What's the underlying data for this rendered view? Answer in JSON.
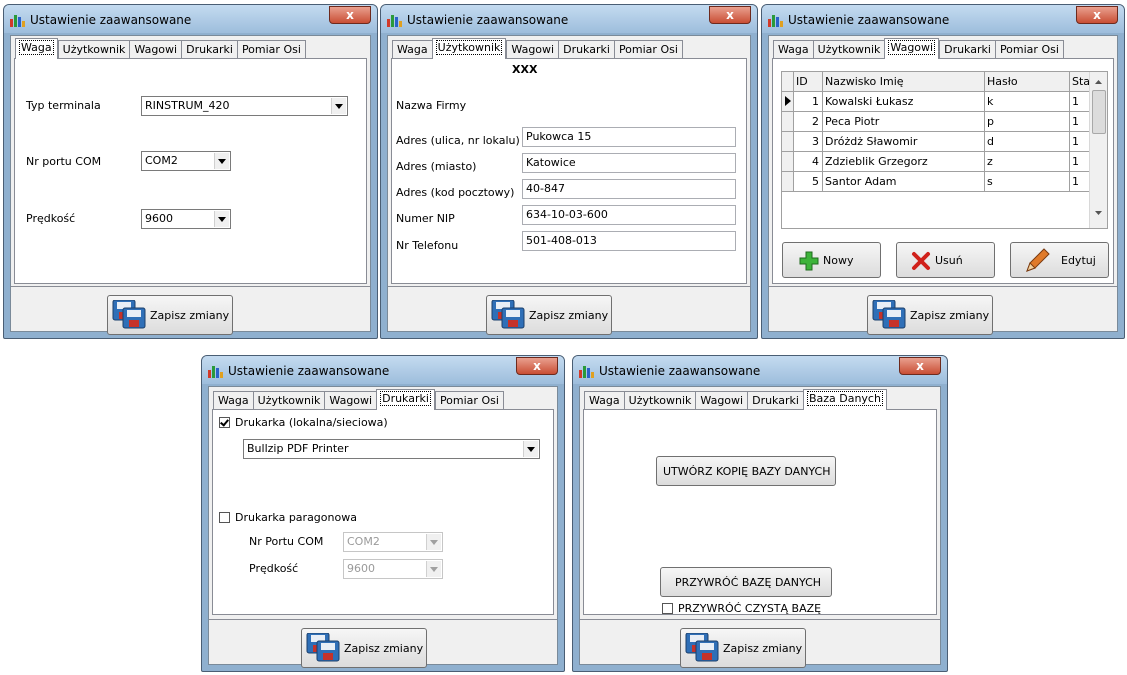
{
  "common": {
    "window_title": "Ustawienie zaawansowane",
    "close_glyph": "x",
    "save_label": "Zapisz zmiany",
    "tabs": [
      "Waga",
      "Użytkownik",
      "Wagowi",
      "Drukarki",
      "Pomiar Osi"
    ],
    "tabs_db": [
      "Waga",
      "Użytkownik",
      "Wagowi",
      "Drukarki",
      "Baza Danych"
    ]
  },
  "waga": {
    "terminal_label": "Typ terminala",
    "terminal_value": "RINSTRUM_420",
    "com_label": "Nr portu COM",
    "com_value": "COM2",
    "speed_label": "Prędkość",
    "speed_value": "9600"
  },
  "uzytkownik": {
    "company_label": "Nazwa Firmy",
    "company_value": "XXX",
    "street_label": "Adres (ulica, nr lokalu)",
    "street_value": "Pukowca 15",
    "city_label": "Adres (miasto)",
    "city_value": "Katowice",
    "zip_label": "Adres (kod pocztowy)",
    "zip_value": "40-847",
    "nip_label": "Numer NIP",
    "nip_value": "634-10-03-600",
    "phone_label": "Nr Telefonu",
    "phone_value": "501-408-013"
  },
  "wagowi": {
    "columns": [
      "ID",
      "Nazwisko Imię",
      "Hasło",
      "Stan"
    ],
    "rows": [
      {
        "id": "1",
        "name": "Kowalski Łukasz",
        "password": "k",
        "state": "1"
      },
      {
        "id": "2",
        "name": "Peca Piotr",
        "password": "p",
        "state": "1"
      },
      {
        "id": "3",
        "name": "Dróżdż Sławomir",
        "password": "d",
        "state": "1"
      },
      {
        "id": "4",
        "name": "Zdzieblik Grzegorz",
        "password": "z",
        "state": "1"
      },
      {
        "id": "5",
        "name": "Santor Adam",
        "password": "s",
        "state": "1"
      }
    ],
    "new_label": "Nowy",
    "delete_label": "Usuń",
    "edit_label": "Edytuj"
  },
  "drukarki": {
    "printer_check_label": "Drukarka (lokalna/sieciowa)",
    "printer_checked": true,
    "printer_value": "Bullzip PDF Printer",
    "receipt_check_label": "Drukarka paragonowa",
    "receipt_checked": false,
    "com_label": "Nr Portu COM",
    "com_value": "COM2",
    "speed_label": "Prędkość",
    "speed_value": "9600"
  },
  "baza": {
    "backup_label": "UTWÓRZ KOPIĘ BAZY DANYCH",
    "restore_label": "PRZYWRÓĆ BAZĘ DANYCH",
    "clean_label": "PRZYWRÓĆ CZYSTĄ BAZĘ",
    "clean_checked": false
  },
  "colors": {
    "frame": "#8fb0cf",
    "close": "#c94e34",
    "panel": "#ffffff",
    "client": "#f0f0f0"
  }
}
